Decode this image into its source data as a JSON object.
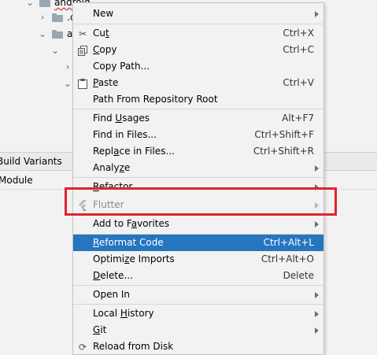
{
  "tree": {
    "rows": [
      {
        "label": "android"
      },
      {
        "label": ".c"
      },
      {
        "label": "a"
      }
    ]
  },
  "build_variants": {
    "title": "Build Variants",
    "module_header": "Module"
  },
  "menu": {
    "items": [
      {
        "label": "New",
        "shortcut": "",
        "submenu": true
      },
      {
        "label": "Cut",
        "mnemonic_pre": "Cu",
        "mnemonic": "t",
        "mnemonic_post": "",
        "shortcut": "Ctrl+X",
        "icon": "scissors-icon"
      },
      {
        "label": "Copy",
        "mnemonic_pre": "",
        "mnemonic": "C",
        "mnemonic_post": "opy",
        "shortcut": "Ctrl+C",
        "icon": "copy-icon"
      },
      {
        "label": "Copy Path...",
        "shortcut": ""
      },
      {
        "label": "Paste",
        "mnemonic_pre": "",
        "mnemonic": "P",
        "mnemonic_post": "aste",
        "shortcut": "Ctrl+V",
        "icon": "clipboard-icon"
      },
      {
        "label": "Path From Repository Root",
        "shortcut": ""
      },
      {
        "label": "Find Usages",
        "mnemonic_pre": "Find ",
        "mnemonic": "U",
        "mnemonic_post": "sages",
        "shortcut": "Alt+F7"
      },
      {
        "label": "Find in Files...",
        "shortcut": "Ctrl+Shift+F"
      },
      {
        "label": "Replace in Files...",
        "mnemonic_pre": "Repl",
        "mnemonic": "a",
        "mnemonic_post": "ce in Files...",
        "shortcut": "Ctrl+Shift+R"
      },
      {
        "label": "Analyze",
        "mnemonic_pre": "Analy",
        "mnemonic": "z",
        "mnemonic_post": "e",
        "submenu": true
      },
      {
        "label": "Refactor",
        "mnemonic_pre": "",
        "mnemonic": "R",
        "mnemonic_post": "efactor",
        "submenu": true
      },
      {
        "label": "Flutter",
        "submenu": true,
        "disabled": true,
        "icon": "flutter-icon"
      },
      {
        "label": "Add to Favorites",
        "mnemonic_pre": "Add to F",
        "mnemonic": "a",
        "mnemonic_post": "vorites",
        "submenu": true
      },
      {
        "label": "Reformat Code",
        "mnemonic_pre": "",
        "mnemonic": "R",
        "mnemonic_post": "eformat Code",
        "shortcut": "Ctrl+Alt+L",
        "selected": true
      },
      {
        "label": "Optimize Imports",
        "mnemonic_pre": "Optimi",
        "mnemonic": "z",
        "mnemonic_post": "e Imports",
        "shortcut": "Ctrl+Alt+O"
      },
      {
        "label": "Delete...",
        "mnemonic_pre": "",
        "mnemonic": "D",
        "mnemonic_post": "elete...",
        "shortcut": "Delete"
      },
      {
        "label": "Open In",
        "submenu": true
      },
      {
        "label": "Local History",
        "mnemonic_pre": "Local ",
        "mnemonic": "H",
        "mnemonic_post": "istory",
        "submenu": true
      },
      {
        "label": "Git",
        "mnemonic_pre": "",
        "mnemonic": "G",
        "mnemonic_post": "it",
        "submenu": true
      },
      {
        "label": "Reload from Disk",
        "icon": "reload-icon"
      }
    ]
  },
  "colors": {
    "menu_bg": "#f2f2f2",
    "selection": "#2675bf",
    "highlight_box": "#e0242a",
    "disabled_text": "#8c8c8c"
  }
}
